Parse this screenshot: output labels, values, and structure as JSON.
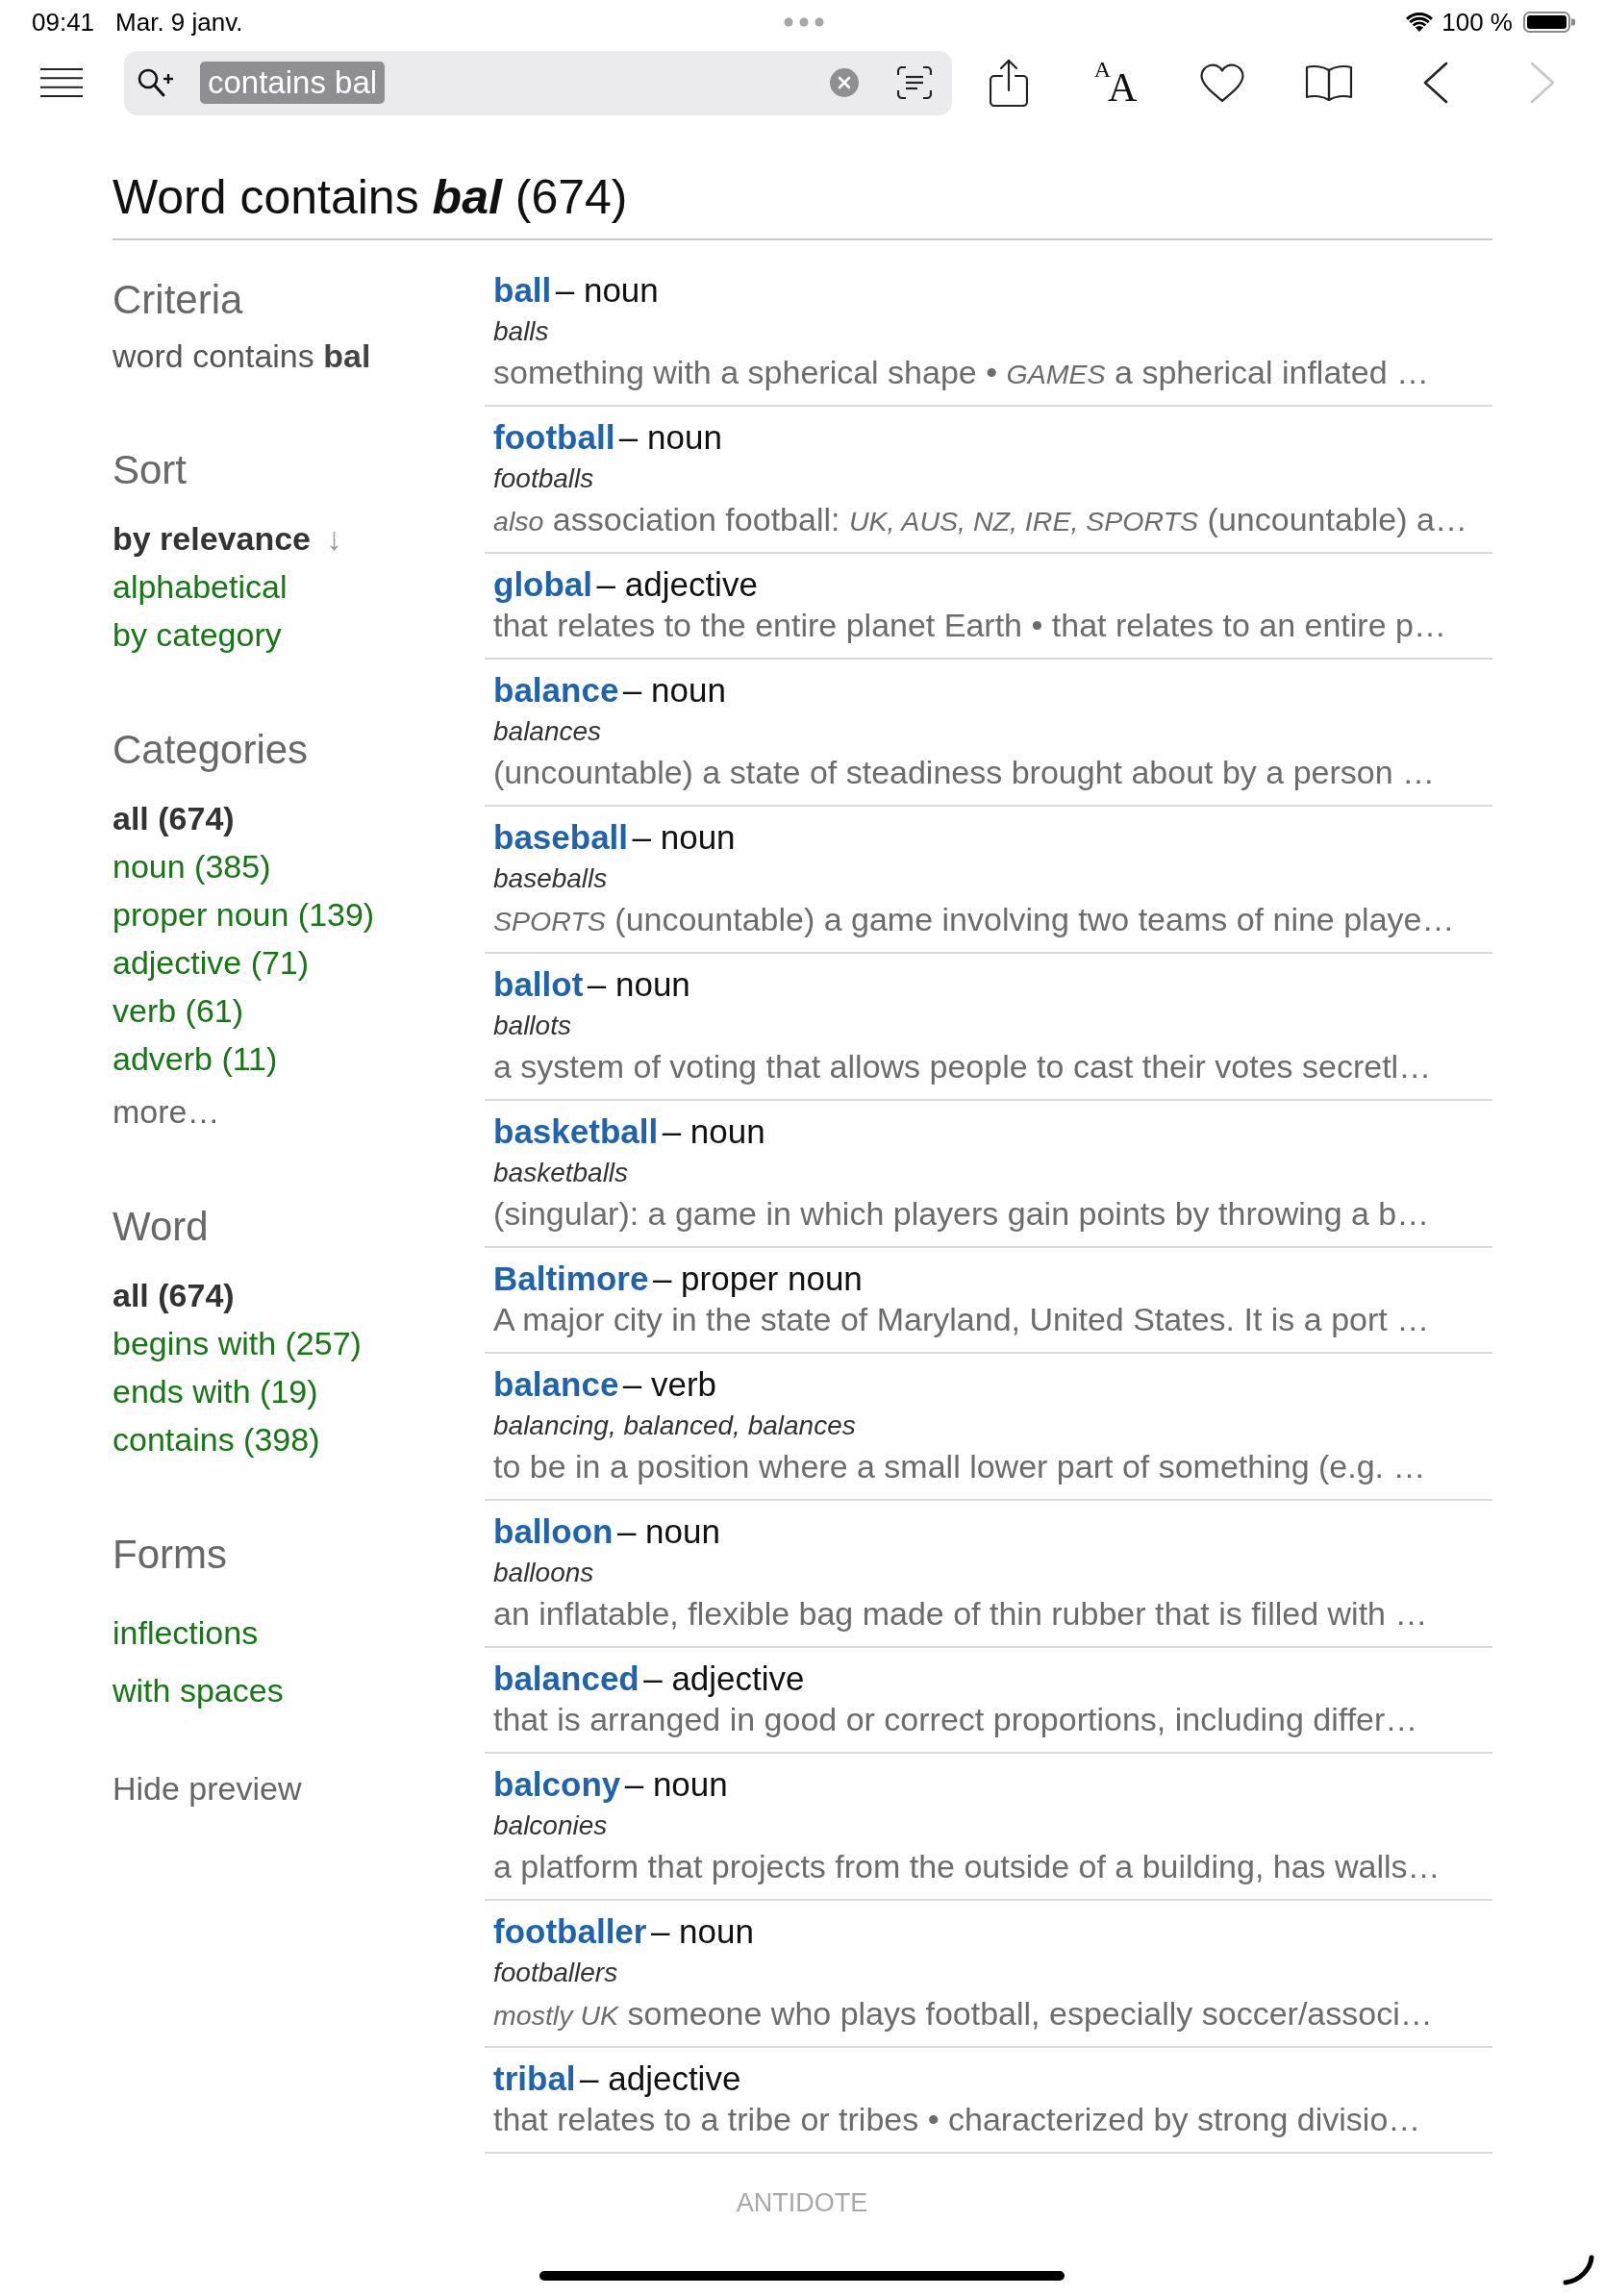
{
  "status_bar": {
    "time": "09:41",
    "date": "Mar. 9 janv.",
    "battery_text": "100 %"
  },
  "toolbar": {
    "search": {
      "value": "contains bal",
      "text_selected": true
    },
    "text_size_glyphs": [
      "A",
      "A"
    ],
    "back": {
      "disabled": false
    },
    "forward": {
      "disabled": true
    }
  },
  "title": {
    "prefix": "Word contains",
    "term": "bal",
    "count": "(674)"
  },
  "sidebar": {
    "criteria": {
      "heading": "Criteria",
      "text": "word contains **bal**"
    },
    "sections": [
      {
        "heading": "Sort",
        "items": [
          {
            "label": "by relevance",
            "selected": true,
            "arrow": "↓"
          },
          {
            "label": "alphabetical",
            "selected": false
          },
          {
            "label": "by category",
            "selected": false
          }
        ]
      },
      {
        "heading": "Categories",
        "items": [
          {
            "label": "all (674)",
            "selected": true,
            "kind": "option"
          },
          {
            "label": "noun (385)",
            "selected": false,
            "kind": "option"
          },
          {
            "label": "proper noun (139)",
            "selected": false,
            "kind": "option"
          },
          {
            "label": "adjective (71)",
            "selected": false,
            "kind": "option"
          },
          {
            "label": "verb (61)",
            "selected": false,
            "kind": "option"
          },
          {
            "label": "adverb (11)",
            "selected": false,
            "kind": "option"
          },
          {
            "label": "more…",
            "selected": false,
            "kind": "more"
          }
        ]
      },
      {
        "heading": "Word",
        "items": [
          {
            "label": "all (674)",
            "selected": true
          },
          {
            "label": "begins with (257)",
            "selected": false
          },
          {
            "label": "ends with (19)",
            "selected": false
          },
          {
            "label": "contains (398)",
            "selected": false
          }
        ]
      },
      {
        "heading": "Forms",
        "items": [
          {
            "label": "inflections",
            "selected": false
          },
          {
            "label": "with spaces",
            "selected": false
          }
        ]
      }
    ],
    "hide_preview": "Hide preview"
  },
  "results": [
    {
      "headword": "ball",
      "pos": "– noun",
      "forms": "balls",
      "definition": "something with a spherical shape • *GAMES* a spherical inflated …"
    },
    {
      "headword": "football",
      "pos": "– noun",
      "forms": "footballs",
      "definition": "*also* association football: *UK, AUS, NZ, IRE, SPORTS* (uncountable) a…"
    },
    {
      "headword": "global",
      "pos": "– adjective",
      "definition": "that relates to the entire planet Earth • that relates to an entire p…"
    },
    {
      "headword": "balance",
      "pos": "– noun",
      "forms": "balances",
      "definition": "(uncountable) a state of steadiness brought about by a person …"
    },
    {
      "headword": "baseball",
      "pos": "– noun",
      "forms": "baseballs",
      "definition": "*SPORTS* (uncountable) a game involving two teams of nine playe…"
    },
    {
      "headword": "ballot",
      "pos": "– noun",
      "forms": "ballots",
      "definition": "a system of voting that allows people to cast their votes secretl…"
    },
    {
      "headword": "basketball",
      "pos": "– noun",
      "forms": "basketballs",
      "definition": "(singular): a game in which players gain points by throwing a b…"
    },
    {
      "headword": "Baltimore",
      "pos": "– proper noun",
      "definition": "A major city in the state of Maryland, United States. It is a port …"
    },
    {
      "headword": "balance",
      "pos": "– verb",
      "forms": "balancing, balanced, balances",
      "definition": "to be in a position where a small lower part of something (e.g. …"
    },
    {
      "headword": "balloon",
      "pos": "– noun",
      "forms": "balloons",
      "definition": "an inflatable, flexible bag made of thin rubber that is filled with …"
    },
    {
      "headword": "balanced",
      "pos": "– adjective",
      "definition": "that is arranged in good or correct proportions, including differ…"
    },
    {
      "headword": "balcony",
      "pos": "– noun",
      "forms": "balconies",
      "definition": "a platform that projects from the outside of a building, has walls…"
    },
    {
      "headword": "footballer",
      "pos": "– noun",
      "forms": "footballers",
      "definition": "*mostly UK* someone who plays football, especially soccer/associ…"
    },
    {
      "headword": "tribal",
      "pos": "– adjective",
      "definition": "that relates to a tribe or tribes • characterized by strong divisio…"
    }
  ],
  "footer": "ANTIDOTE"
}
